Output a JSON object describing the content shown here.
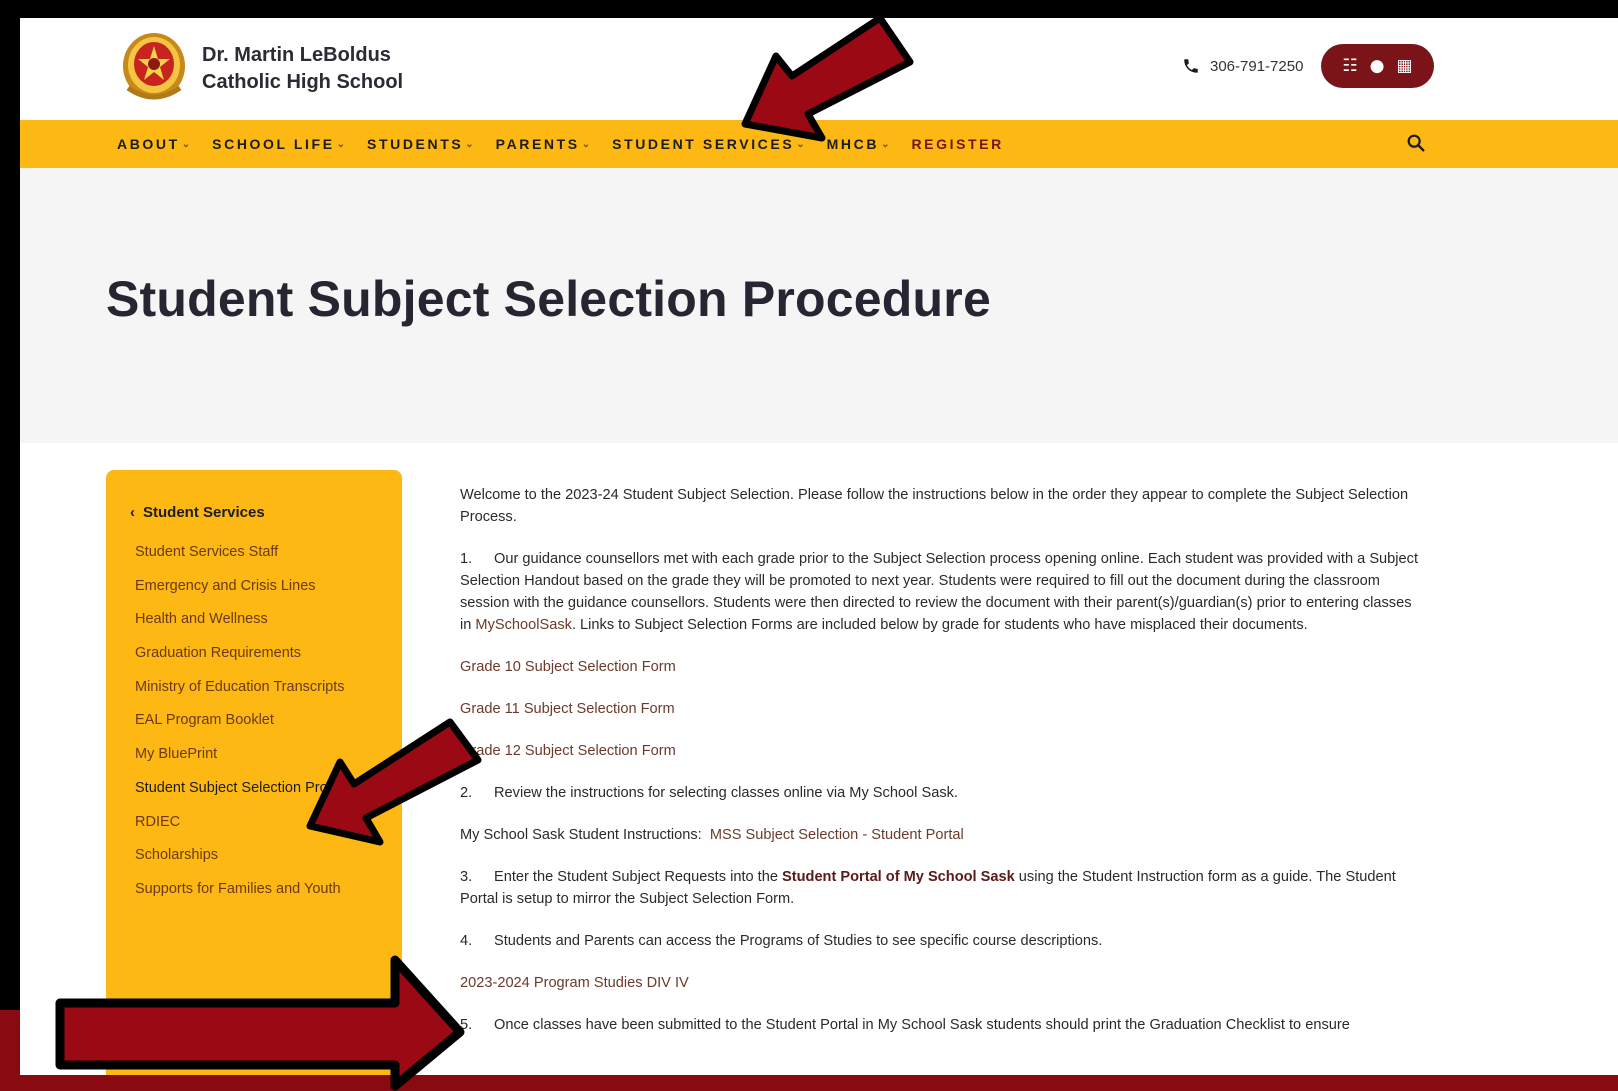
{
  "header": {
    "school_name_line1": "Dr. Martin LeBoldus",
    "school_name_line2": "Catholic High School",
    "phone": "306-791-7250"
  },
  "nav": {
    "items": [
      {
        "label": "ABOUT",
        "has_dropdown": true
      },
      {
        "label": "SCHOOL LIFE",
        "has_dropdown": true
      },
      {
        "label": "STUDENTS",
        "has_dropdown": true
      },
      {
        "label": "PARENTS",
        "has_dropdown": true
      },
      {
        "label": "STUDENT SERVICES",
        "has_dropdown": true
      },
      {
        "label": "MHCB",
        "has_dropdown": true
      },
      {
        "label": "REGISTER",
        "has_dropdown": false
      }
    ],
    "search_icon": "search-icon"
  },
  "hero": {
    "title": "Student Subject Selection Procedure"
  },
  "sidebar": {
    "back_label": "Student Services",
    "items": [
      "Student Services Staff",
      "Emergency and Crisis Lines",
      "Health and Wellness",
      "Graduation Requirements",
      "Ministry of Education Transcripts",
      "EAL Program Booklet",
      "My BluePrint",
      "Student Subject Selection Procedure",
      "RDIEC",
      "Scholarships",
      "Supports for Families and Youth"
    ],
    "active_index": 7
  },
  "content": {
    "intro": "Welcome to the 2023-24 Student Subject Selection. Please follow the instructions below in the order they appear to complete the Subject Selection Process.",
    "step1_num": "1.",
    "step1_text_a": "Our guidance counsellors met with each grade prior to the Subject Selection process opening online. Each student was provided with a Subject Selection Handout based on the grade they will be promoted to next year. Students were required to fill out the document during the classroom session with the guidance counsellors. Students were then directed to review the document with their parent(s)/guardian(s) prior to entering classes in ",
    "step1_link": "MySchoolSask",
    "step1_text_b": ". Links to Subject Selection Forms are included below by grade for students who have misplaced their documents.",
    "grade10_link": "Grade 10 Subject Selection Form",
    "grade11_link": "Grade 11 Subject Selection Form",
    "grade12_link": "Grade 12 Subject Selection Form",
    "step2_num": "2.",
    "step2_text": "Review the instructions for selecting classes online via My School Sask.",
    "mss_label": "My School Sask Student Instructions:",
    "mss_link": "MSS Subject Selection - Student Portal",
    "step3_num": "3.",
    "step3_text_a": "Enter the Student Subject Requests into the ",
    "step3_strong": "Student Portal of My School Sask",
    "step3_text_b": " using the Student Instruction form as a guide. The Student Portal is setup to mirror the Subject Selection Form.",
    "step4_num": "4.",
    "step4_text": "Students and Parents can access the Programs of Studies to see specific course descriptions.",
    "program_link": "2023-2024 Program Studies DIV IV",
    "step5_num": "5.",
    "step5_text": "Once classes have been submitted to the Student Portal in My School Sask students should print the Graduation Checklist to ensure"
  },
  "colors": {
    "nav_gold": "#fdb813",
    "maroon": "#7a1418",
    "arrow_red": "#9b0a14",
    "hero_bg": "#f5f5f5"
  }
}
